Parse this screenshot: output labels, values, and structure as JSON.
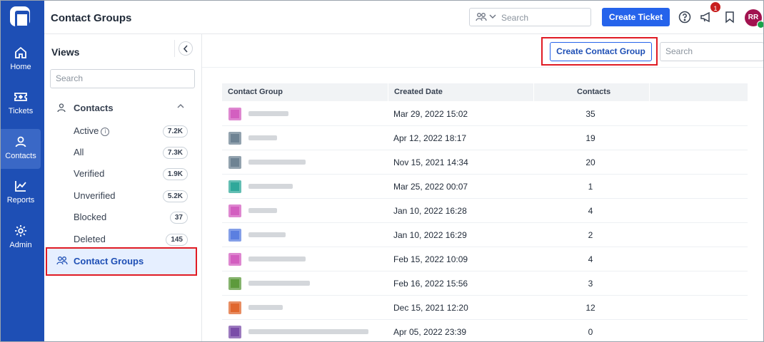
{
  "rail": {
    "items": [
      {
        "label": "Home",
        "icon": "home-icon"
      },
      {
        "label": "Tickets",
        "icon": "ticket-icon"
      },
      {
        "label": "Contacts",
        "icon": "person-icon"
      },
      {
        "label": "Reports",
        "icon": "chart-icon"
      },
      {
        "label": "Admin",
        "icon": "gear-icon"
      }
    ],
    "active": "Contacts"
  },
  "header": {
    "title": "Contact Groups",
    "search_placeholder": "Search",
    "create_ticket": "Create Ticket",
    "notification_count": "1",
    "avatar_initials": "RR"
  },
  "views": {
    "title": "Views",
    "search_placeholder": "Search",
    "group_label": "Contacts",
    "items": [
      {
        "label": "Active",
        "count": "7.2K"
      },
      {
        "label": "All",
        "count": "7.3K"
      },
      {
        "label": "Verified",
        "count": "1.9K"
      },
      {
        "label": "Unverified",
        "count": "5.2K"
      },
      {
        "label": "Blocked",
        "count": "37"
      },
      {
        "label": "Deleted",
        "count": "145"
      }
    ],
    "active_item": "Contact Groups"
  },
  "main": {
    "create_button": "Create Contact Group",
    "search_placeholder": "Search",
    "columns": [
      "Contact Group",
      "Created Date",
      "Contacts"
    ],
    "rows": [
      {
        "created": "Mar 29, 2022 15:02",
        "contacts": "35",
        "color": "#d35fc0"
      },
      {
        "created": "Apr 12, 2022 18:17",
        "contacts": "19",
        "color": "#6e8393"
      },
      {
        "created": "Nov 15, 2021 14:34",
        "contacts": "20",
        "color": "#6e8393"
      },
      {
        "created": "Mar 25, 2022 00:07",
        "contacts": "1",
        "color": "#2fa89a"
      },
      {
        "created": "Jan 10, 2022 16:28",
        "contacts": "4",
        "color": "#d35fc0"
      },
      {
        "created": "Jan 10, 2022 16:29",
        "contacts": "2",
        "color": "#5b7fe0"
      },
      {
        "created": "Feb 15, 2022 10:09",
        "contacts": "4",
        "color": "#d35fc0"
      },
      {
        "created": "Feb 16, 2022 15:56",
        "contacts": "3",
        "color": "#5d9a3c"
      },
      {
        "created": "Dec 15, 2021 12:20",
        "contacts": "12",
        "color": "#e0672e"
      },
      {
        "created": "Apr 05, 2022 23:39",
        "contacts": "0",
        "color": "#7a4da8"
      }
    ]
  },
  "colors": {
    "rail_bg": "#1e4fb5",
    "primary": "#2563eb",
    "highlight": "#e01b24"
  }
}
